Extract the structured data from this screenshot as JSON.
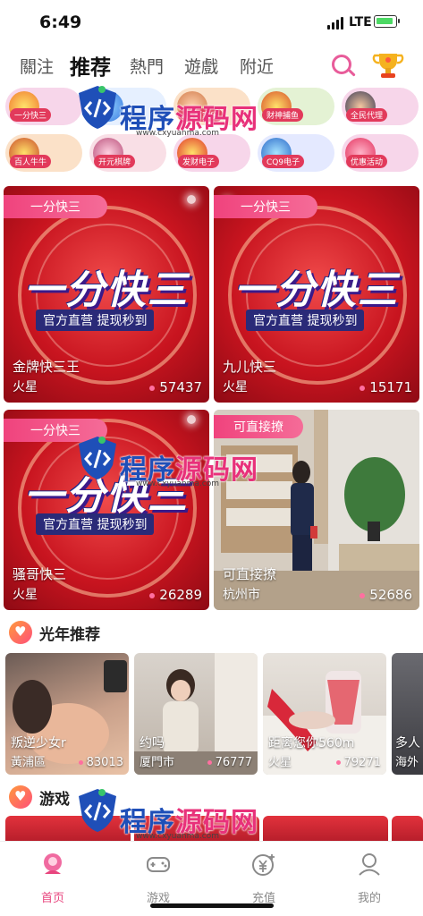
{
  "status": {
    "time": "6:49",
    "network": "LTE"
  },
  "nav": {
    "tabs": [
      "關注",
      "推荐",
      "熱門",
      "遊戲",
      "附近"
    ],
    "active_index": 1
  },
  "games": [
    {
      "label": "一分快三",
      "bg": "#f7d6ea"
    },
    {
      "label": "",
      "bg": "#e6f0ff"
    },
    {
      "label": "AG百家乐",
      "bg": "#fbe1c8"
    },
    {
      "label": "财神捕鱼",
      "bg": "#e4f2d4"
    },
    {
      "label": "全民代理",
      "bg": "#f7d6ea"
    },
    {
      "label": "百人牛牛",
      "bg": "#fbe1c8"
    },
    {
      "label": "开元棋牌",
      "bg": "#f9dfe6"
    },
    {
      "label": "发财电子",
      "bg": "#f7d6ea"
    },
    {
      "label": "CQ9电子",
      "bg": "#e4e9ff"
    },
    {
      "label": "优惠活动",
      "bg": "#f7d6ea"
    }
  ],
  "watermark": {
    "site_blue": "程序",
    "site_pink": "源码网",
    "url": "www.cxyuanma.com"
  },
  "promo": {
    "ribbon": "一分快三",
    "headline": "一分快三",
    "subline": "官方直营 提现秒到"
  },
  "cards": [
    {
      "name": "金牌快三王",
      "location": "火星",
      "count": "57437"
    },
    {
      "name": "九儿快三",
      "location": "火星",
      "count": "15171"
    },
    {
      "name": "骚哥快三",
      "location": "火星",
      "count": "26289"
    },
    {
      "ribbon": "可直接撩",
      "name": "可直接撩",
      "location": "杭州市",
      "count": "52686"
    }
  ],
  "section_recommend": {
    "title": "光年推荐"
  },
  "small_cards": [
    {
      "name": "叛逆少女r",
      "location": "黃浦區",
      "count": "83013"
    },
    {
      "name": "约吗",
      "location": "厦門市",
      "count": "76777"
    },
    {
      "name": "距离您你560m",
      "location": "火星",
      "count": "79271"
    },
    {
      "name": "多人",
      "location": "海外"
    }
  ],
  "section_games": {
    "title": "游戏"
  },
  "tabbar": {
    "items": [
      "首页",
      "游戏",
      "充值",
      "我的"
    ],
    "active_index": 0
  },
  "colors": {
    "accent_pink": "#e8457e",
    "promo_red": "#c8141f",
    "watermark_blue": "#1f4fb8"
  }
}
